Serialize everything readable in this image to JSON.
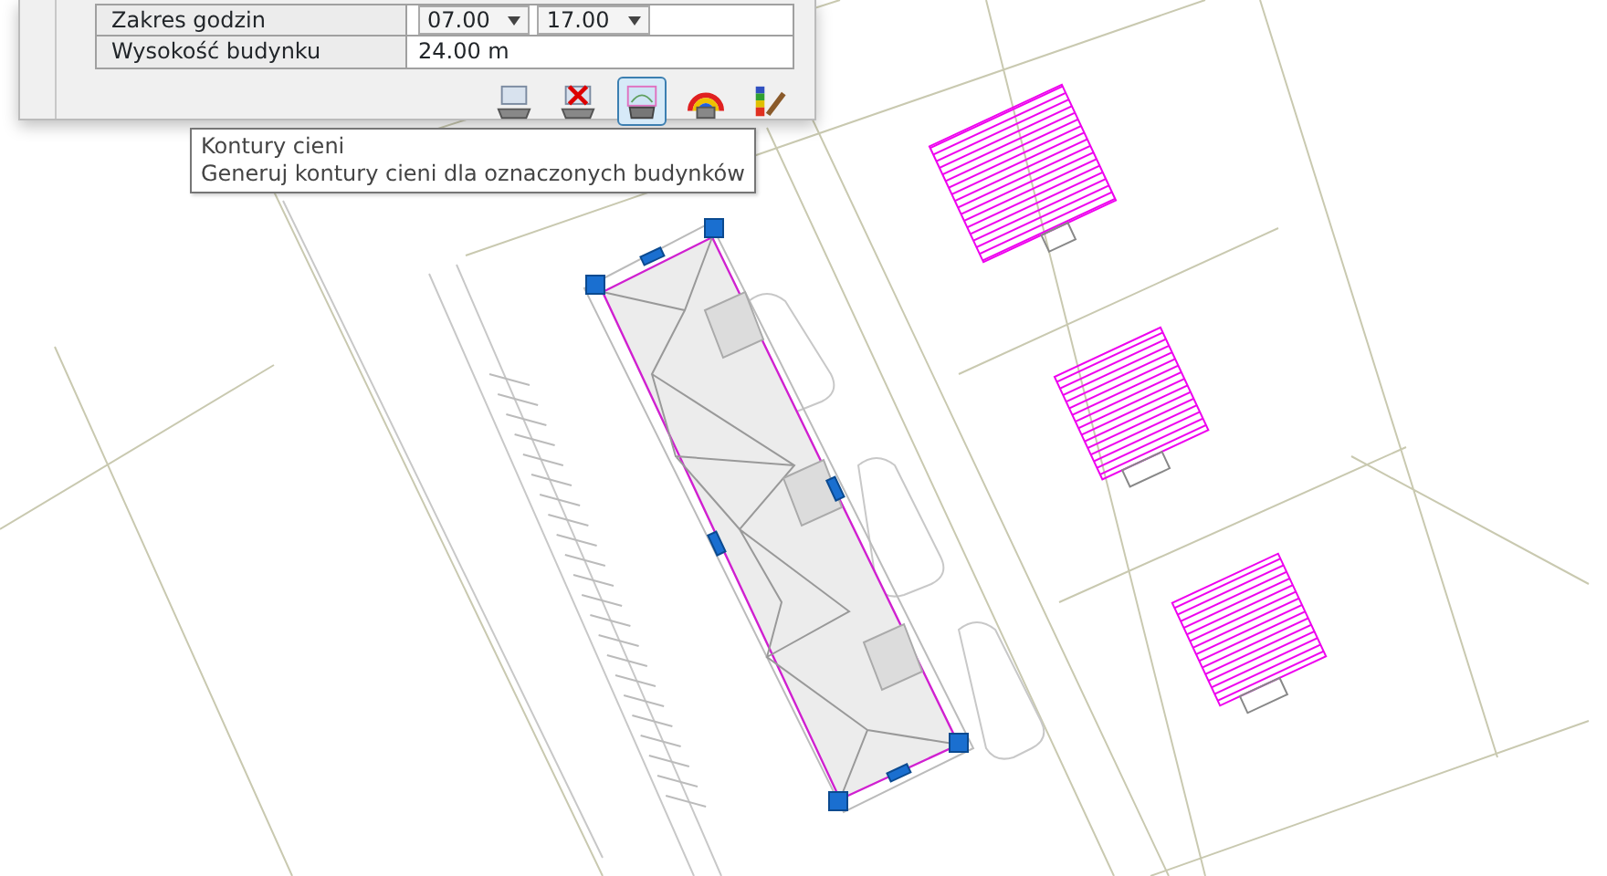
{
  "panel": {
    "rows": [
      {
        "kind": "time-range",
        "label": "Zakres godzin",
        "from": "07.00",
        "to": "17.00"
      },
      {
        "kind": "text",
        "label": "Wysokość budynku",
        "value": "24.00 m"
      }
    ],
    "tools": [
      {
        "kind": "layer",
        "selected": false
      },
      {
        "kind": "delete",
        "selected": false
      },
      {
        "kind": "contours",
        "selected": true
      },
      {
        "kind": "rainbow",
        "selected": false
      },
      {
        "kind": "palette",
        "selected": false
      }
    ]
  },
  "tooltip": {
    "title": "Kontury cieni",
    "text": "Generuj kontury cieni dla oznaczonych budynków"
  }
}
